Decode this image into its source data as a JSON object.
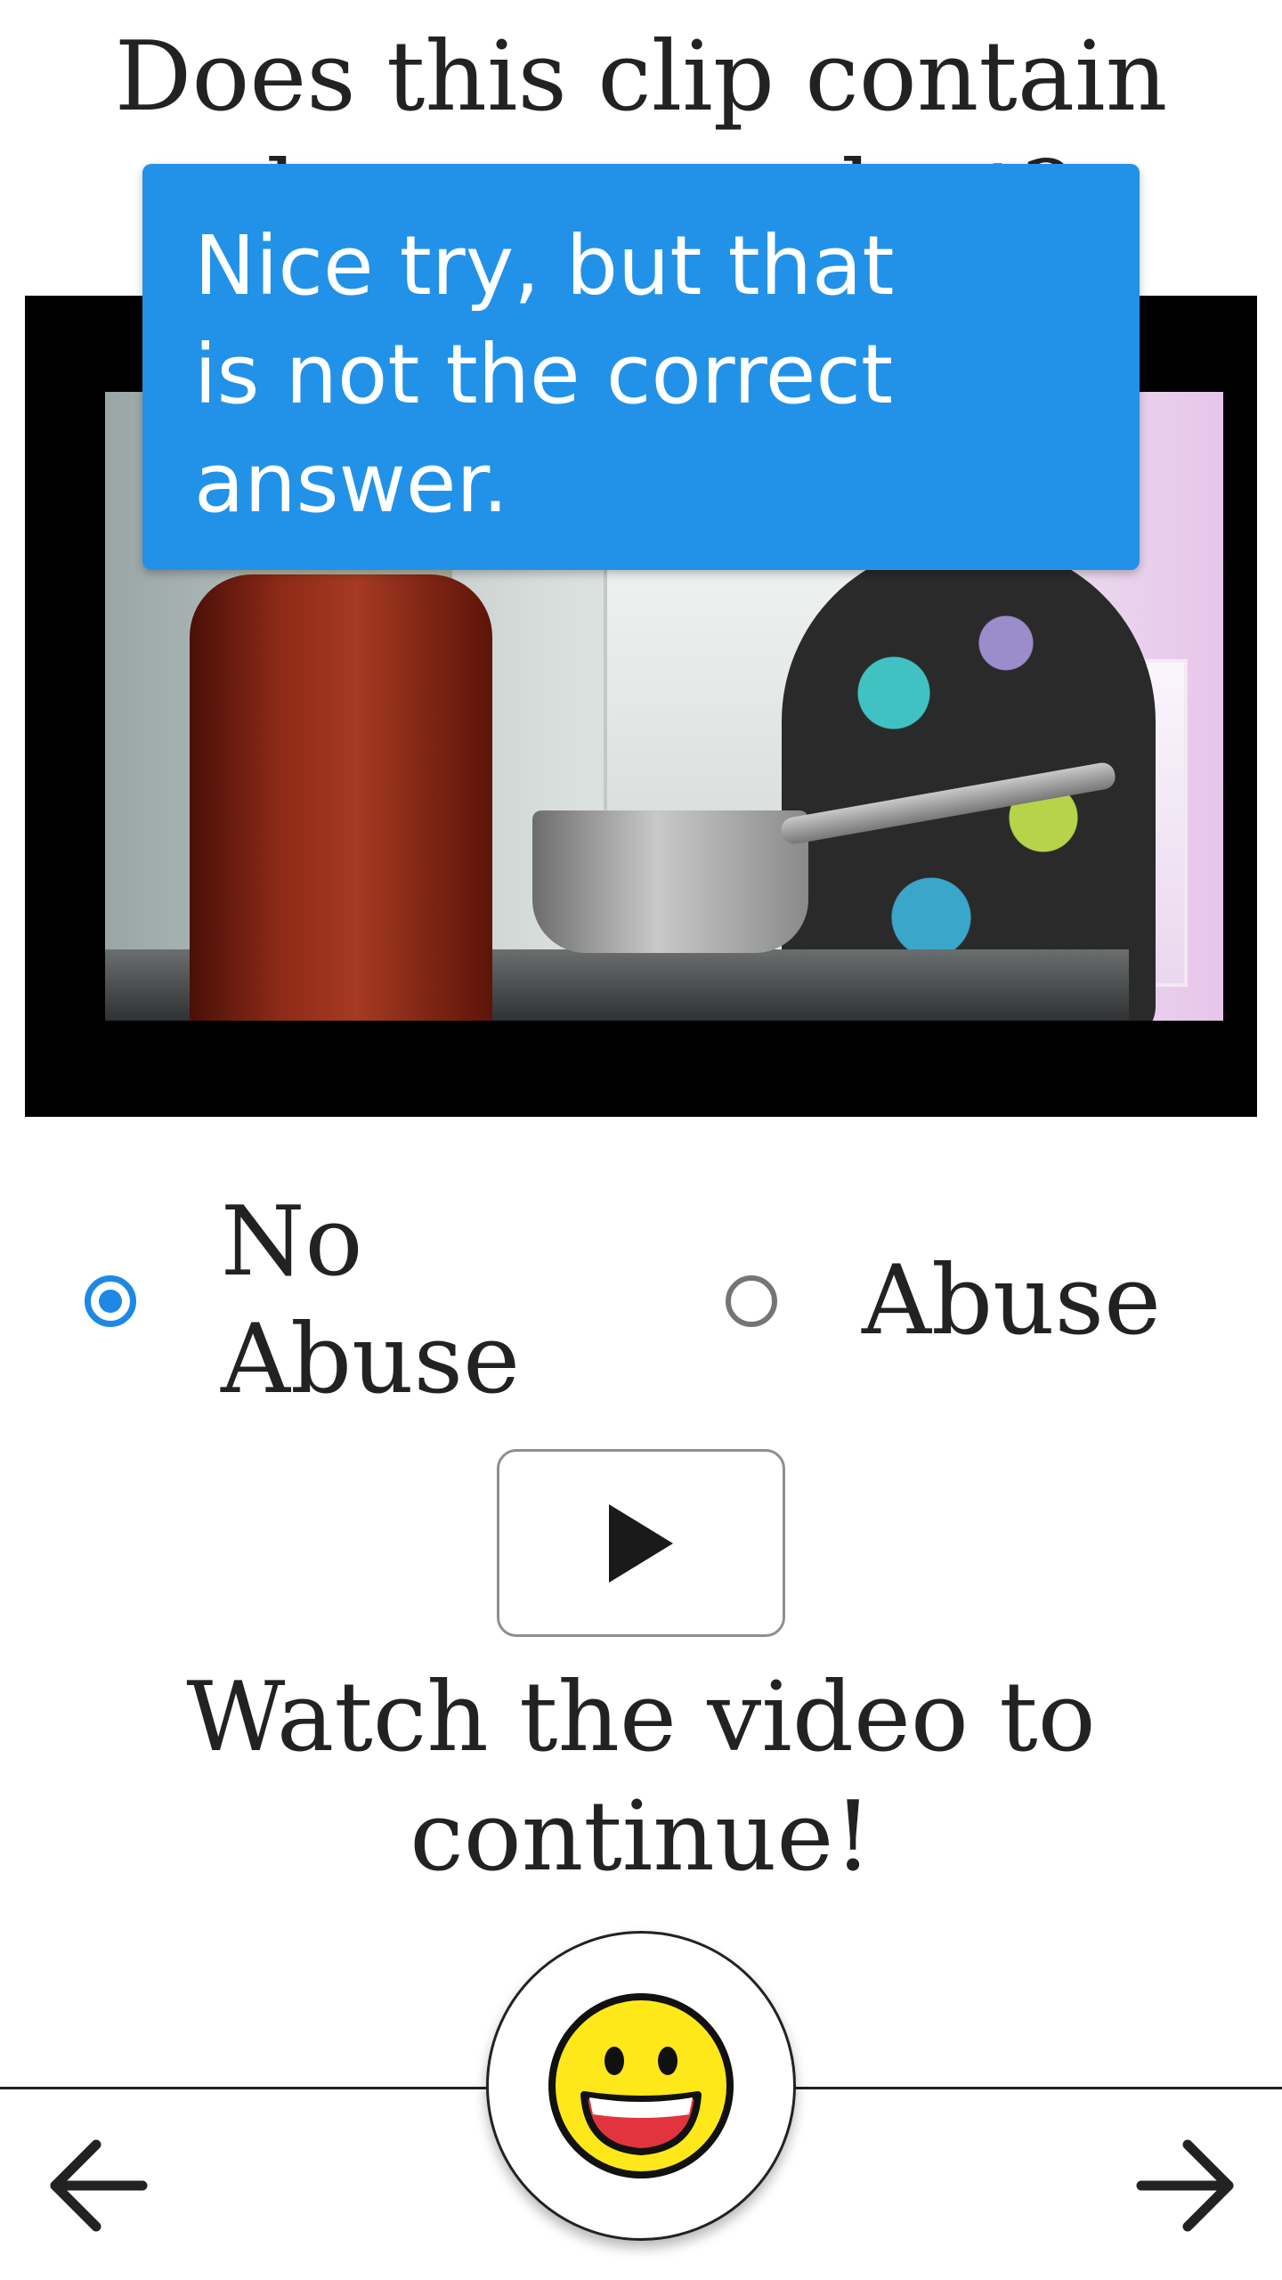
{
  "question": {
    "text": "Does this clip contain abuse or neglect?"
  },
  "toast": {
    "message": "Nice try, but that is not the correct answer.",
    "color": "#2292e8"
  },
  "options": [
    {
      "label": "No Abuse",
      "selected": true
    },
    {
      "label": "Abuse",
      "selected": false
    }
  ],
  "accent_color": "#1e88e5",
  "play_button": {
    "icon": "play-icon"
  },
  "instruction": {
    "text": "Watch the video to continue!"
  },
  "nav": {
    "back_icon": "arrow-left-icon",
    "forward_icon": "arrow-right-icon",
    "center_icon": "grinning-face-emoji"
  }
}
